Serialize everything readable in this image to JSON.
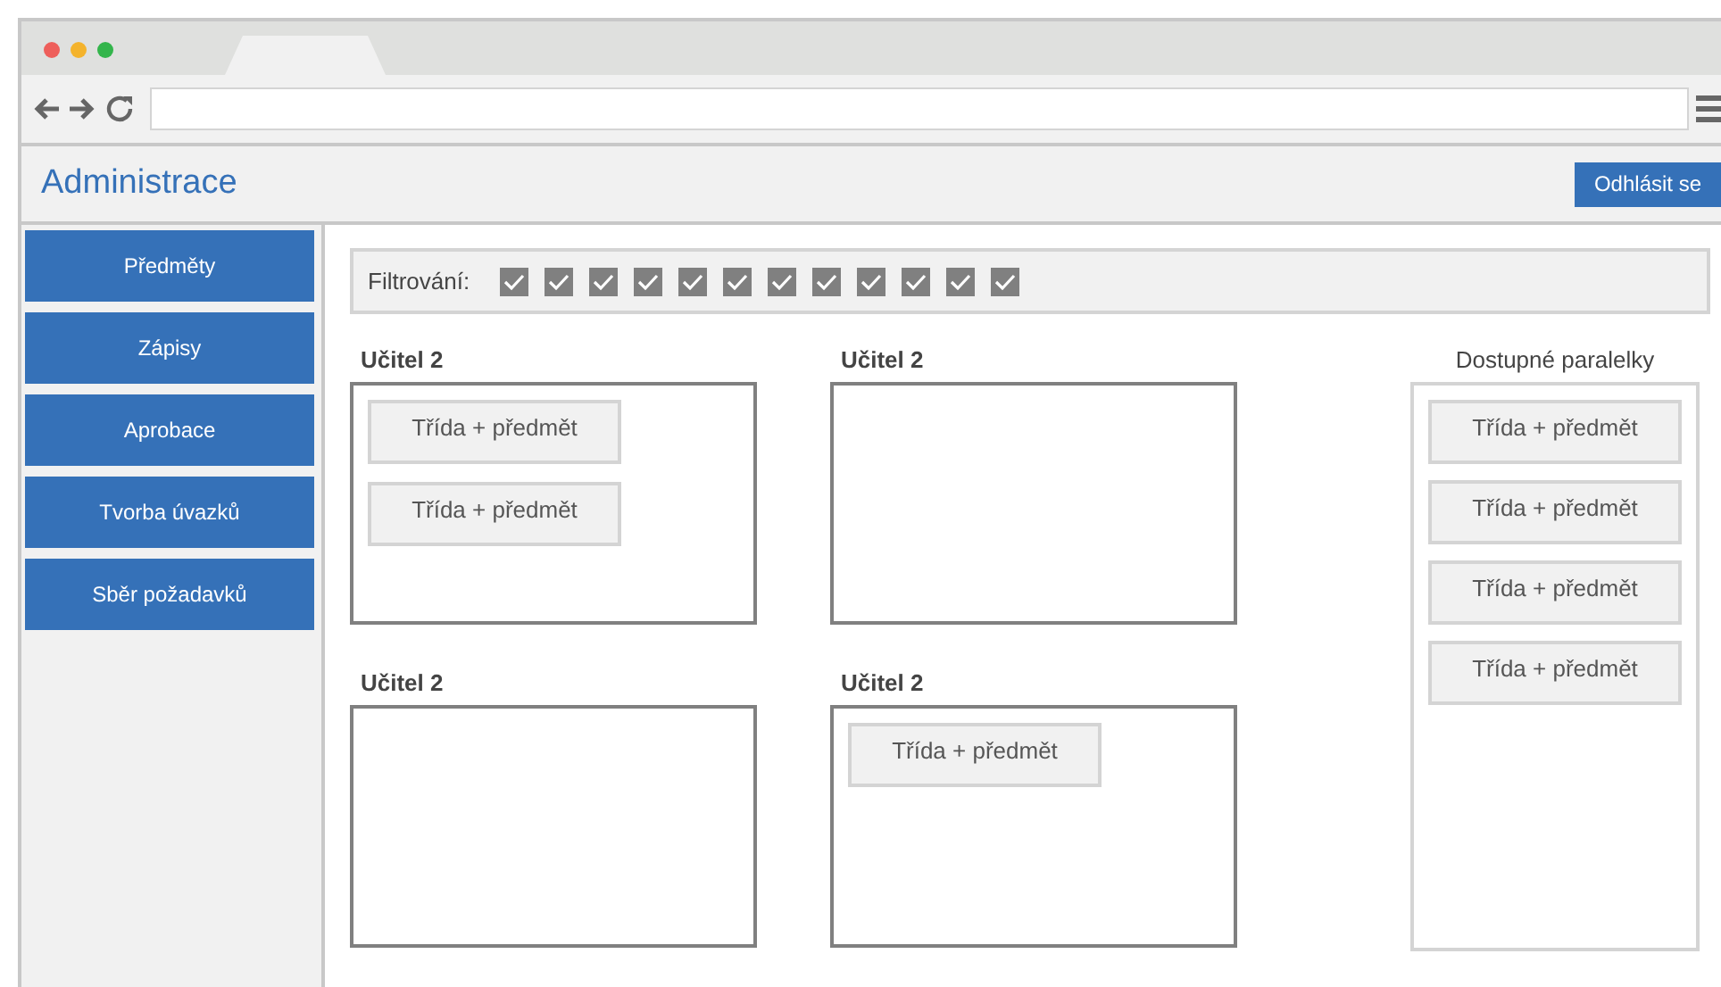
{
  "app": {
    "title": "Administrace",
    "logout": "Odhlásit se"
  },
  "sidebar": {
    "items": [
      {
        "label": "Předměty"
      },
      {
        "label": "Zápisy"
      },
      {
        "label": "Aprobace"
      },
      {
        "label": "Tvorba úvazků"
      },
      {
        "label": "Sběr požadavků"
      }
    ]
  },
  "filter": {
    "label": "Filtrování:",
    "checkboxes": [
      {
        "checked": true
      },
      {
        "checked": true
      },
      {
        "checked": true
      },
      {
        "checked": true
      },
      {
        "checked": true
      },
      {
        "checked": true
      },
      {
        "checked": true
      },
      {
        "checked": true
      },
      {
        "checked": true
      },
      {
        "checked": true
      },
      {
        "checked": true
      },
      {
        "checked": true
      }
    ]
  },
  "teachers": [
    {
      "name": "Učitel 2",
      "cards": [
        "Třída + předmět",
        "Třída + předmět"
      ]
    },
    {
      "name": "Učitel 2"
    },
    {
      "name": "Učitel 2"
    },
    {
      "name": "Učitel 2",
      "cards": [
        "Třída + předmět"
      ]
    }
  ],
  "available": {
    "title": "Dostupné paralelky",
    "cards": [
      "Třída + předmět",
      "Třída + předmět",
      "Třída + předmět",
      "Třída + předmět"
    ]
  }
}
